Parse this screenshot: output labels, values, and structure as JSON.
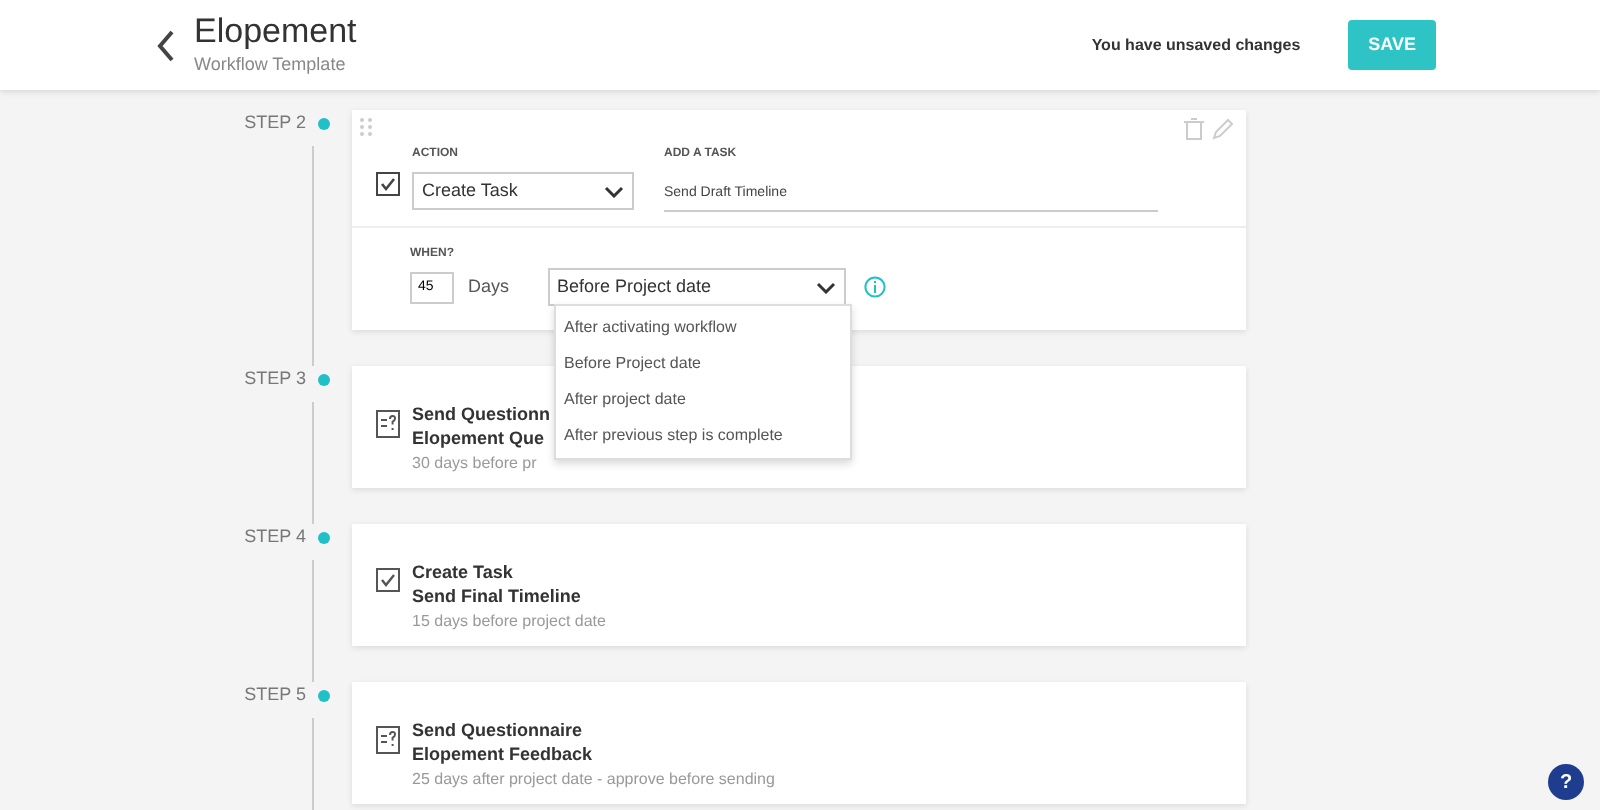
{
  "header": {
    "title": "Elopement",
    "subtitle": "Workflow Template",
    "notice": "You have unsaved changes",
    "save_label": "SAVE"
  },
  "steps": [
    {
      "kind": "editor",
      "label": "STEP 2",
      "action_label": "ACTION",
      "action_value": "Create Task",
      "action_checked": true,
      "task_label": "ADD A TASK",
      "task_value": "Send Draft Timeline",
      "when_label": "WHEN?",
      "days_value": "45",
      "days_unit": "Days",
      "timing_value": "Before Project date",
      "timing_expanded": true,
      "timing_options": [
        {
          "label": "After activating workflow",
          "selected": false
        },
        {
          "label": "Before Project date",
          "selected": false
        },
        {
          "label": "After project date",
          "selected": false
        },
        {
          "label": "After previous step is complete",
          "selected": false
        }
      ]
    },
    {
      "kind": "questionnaire",
      "label": "STEP 3",
      "title": "Send Questionn",
      "subject": "Elopement Que",
      "detail": "30 days before pr"
    },
    {
      "kind": "task",
      "label": "STEP 4",
      "title": "Create Task",
      "subject": "Send Final Timeline",
      "detail": "15 days before project date"
    },
    {
      "kind": "questionnaire",
      "label": "STEP 5",
      "title": "Send Questionnaire",
      "subject": "Elopement Feedback",
      "detail": "25 days after project date - approve before sending"
    }
  ],
  "help_label": "?"
}
